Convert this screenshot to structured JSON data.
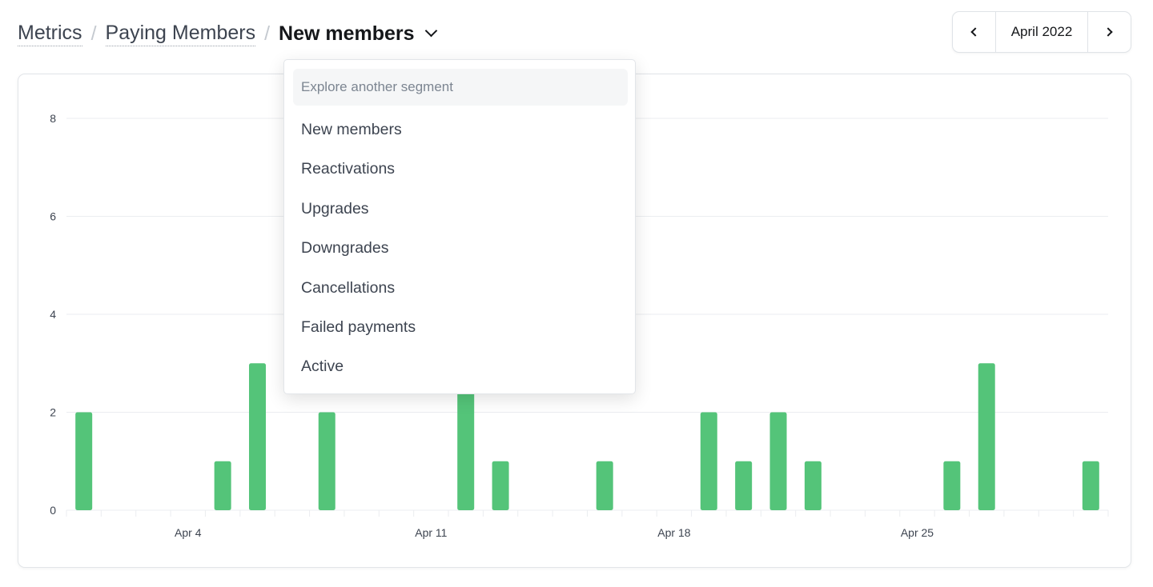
{
  "breadcrumb": {
    "items": [
      "Metrics",
      "Paying Members"
    ],
    "separator": "/",
    "current": "New members"
  },
  "month_nav": {
    "label": "April 2022"
  },
  "dropdown": {
    "search_placeholder": "Explore another segment",
    "items": [
      "New members",
      "Reactivations",
      "Upgrades",
      "Downgrades",
      "Cancellations",
      "Failed payments",
      "Active"
    ]
  },
  "colors": {
    "bar": "#54c479",
    "grid": "#ebedf0",
    "text": "#15171a",
    "muted": "#3d4450"
  },
  "chart_data": {
    "type": "bar",
    "title": "",
    "xlabel": "",
    "ylabel": "",
    "ylim": [
      0,
      8
    ],
    "y_ticks": [
      0,
      2,
      4,
      6,
      8
    ],
    "x_tick_labels": [
      {
        "day": 4,
        "label": "Apr 4"
      },
      {
        "day": 11,
        "label": "Apr 11"
      },
      {
        "day": 18,
        "label": "Apr 18"
      },
      {
        "day": 25,
        "label": "Apr 25"
      }
    ],
    "categories": [
      "Apr 1",
      "Apr 2",
      "Apr 3",
      "Apr 4",
      "Apr 5",
      "Apr 6",
      "Apr 7",
      "Apr 8",
      "Apr 9",
      "Apr 10",
      "Apr 11",
      "Apr 12",
      "Apr 13",
      "Apr 14",
      "Apr 15",
      "Apr 16",
      "Apr 17",
      "Apr 18",
      "Apr 19",
      "Apr 20",
      "Apr 21",
      "Apr 22",
      "Apr 23",
      "Apr 24",
      "Apr 25",
      "Apr 26",
      "Apr 27",
      "Apr 28",
      "Apr 29",
      "Apr 30"
    ],
    "values": [
      2,
      0,
      0,
      0,
      1,
      3,
      0,
      2,
      0,
      0,
      0,
      3,
      1,
      0,
      0,
      1,
      0,
      0,
      2,
      1,
      2,
      1,
      0,
      0,
      0,
      1,
      3,
      0,
      0,
      1
    ],
    "grid": true,
    "legend": "none"
  }
}
